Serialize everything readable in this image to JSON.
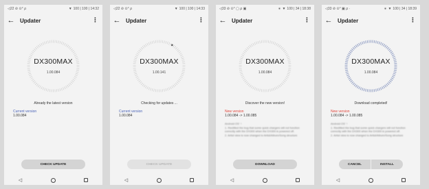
{
  "screens": [
    {
      "status_time": "◁22 ⊘ ⊙° ⍴",
      "status_right": "100 | 100 | 14:32",
      "title": "Updater",
      "model": "DX300MAX",
      "version": "1.00.084",
      "message": "Already the latest version",
      "label": "Current version",
      "label_version": "1.00.084",
      "button": "CHECK UPDATE"
    },
    {
      "status_time": "◁22 ⊘ ⊙° ⍴",
      "status_right": "100 | 100 | 14:33",
      "title": "Updater",
      "model": "DX300MAX",
      "version": "1.00.141",
      "message": "Checking for updates ...",
      "label": "Current version",
      "label_version": "1.00.084",
      "button": "CHECK UPDATE"
    },
    {
      "status_time": "◁33 ⊘ ⊙° ▢ ⍴ ▣",
      "status_right": "100 | 34 | 18:38",
      "title": "Updater",
      "model": "DX300MAX",
      "version": "1.00.084",
      "message": "Discover the new version!",
      "label": "New version",
      "label_version": "1.00.084 -> 1.00.085",
      "notes": "Android OS' ↑\n1. Rectified the bug that some quick chargers will not function correctly with the DX300 when the DX300 is powered off.\n2. Artist view is now changed to Artist/Album/Song structure",
      "button": "DOWNLOAD"
    },
    {
      "status_time": "◁33 ⊘ ⊙° ▣ ⍴ ·",
      "status_right": "100 | 34 | 18:39",
      "title": "Updater",
      "model": "DX300MAX",
      "version": "1.00.084",
      "message": "Download completed!",
      "label": "New version",
      "label_version": "1.00.084 -> 1.00.085",
      "notes": "Android OS' ↑\n1. Rectified the bug that some quick chargers will not function correctly with the DX300 when the DX300 is powered off.\n2. Artist view is now changed to Artist/Album/Song structure",
      "button_left": "CANCEL",
      "button_right": "INSTALL"
    }
  ],
  "colors": {
    "current_label": "#4a63b8",
    "new_label": "#e0443a",
    "dial_light": "#cfcfcf",
    "dial_progress": "#9aa6c8"
  }
}
